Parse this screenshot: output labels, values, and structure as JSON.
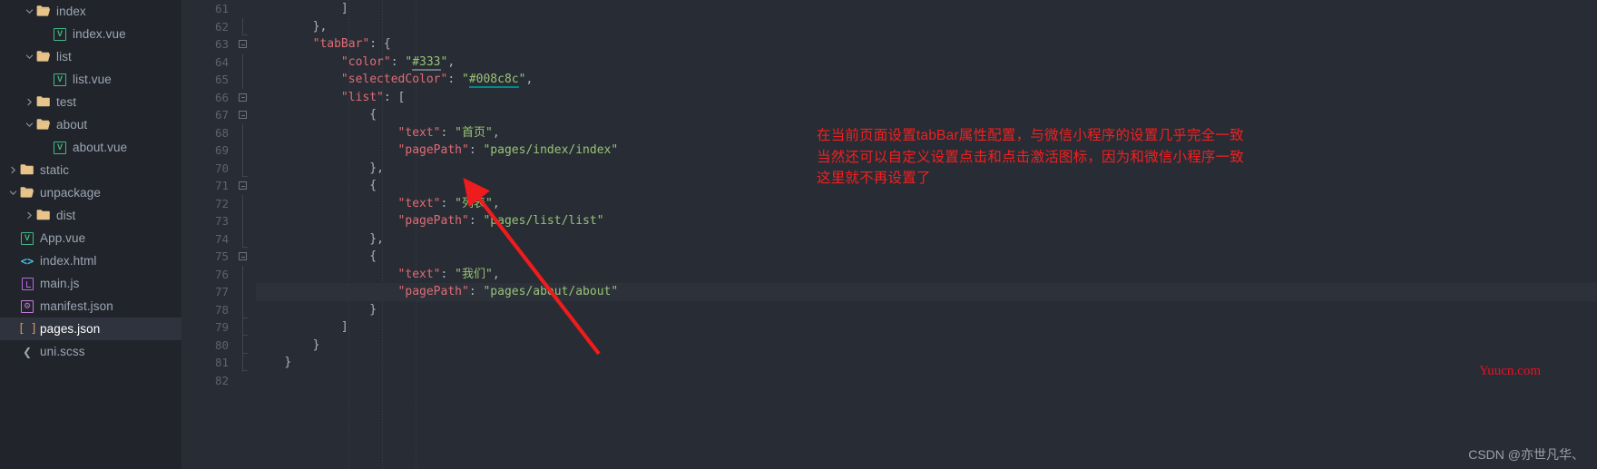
{
  "sidebar": {
    "items": [
      {
        "label": "index",
        "level": 2,
        "chevron": "down",
        "icon": "folder-open-icon",
        "selected": false
      },
      {
        "label": "index.vue",
        "level": 3,
        "chevron": "none",
        "icon": "vue-file-icon",
        "selected": false
      },
      {
        "label": "list",
        "level": 2,
        "chevron": "down",
        "icon": "folder-open-icon",
        "selected": false
      },
      {
        "label": "list.vue",
        "level": 3,
        "chevron": "none",
        "icon": "vue-file-icon",
        "selected": false
      },
      {
        "label": "test",
        "level": 2,
        "chevron": "right",
        "icon": "folder-icon",
        "selected": false
      },
      {
        "label": "about",
        "level": 2,
        "chevron": "down",
        "icon": "folder-open-icon",
        "selected": false
      },
      {
        "label": "about.vue",
        "level": 3,
        "chevron": "none",
        "icon": "vue-file-icon",
        "selected": false
      },
      {
        "label": "static",
        "level": 1,
        "chevron": "right",
        "icon": "folder-icon",
        "selected": false
      },
      {
        "label": "unpackage",
        "level": 1,
        "chevron": "down",
        "icon": "folder-open-icon",
        "selected": false
      },
      {
        "label": "dist",
        "level": 2,
        "chevron": "right",
        "icon": "folder-icon",
        "selected": false
      },
      {
        "label": "App.vue",
        "level": 1,
        "chevron": "none",
        "icon": "vue-file-icon",
        "selected": false
      },
      {
        "label": "index.html",
        "level": 1,
        "chevron": "none",
        "icon": "html-file-icon",
        "selected": false
      },
      {
        "label": "main.js",
        "level": 1,
        "chevron": "none",
        "icon": "js-file-icon",
        "selected": false
      },
      {
        "label": "manifest.json",
        "level": 1,
        "chevron": "none",
        "icon": "manifest-file-icon",
        "selected": false
      },
      {
        "label": "pages.json",
        "level": 1,
        "chevron": "none",
        "icon": "json-file-icon",
        "selected": true
      },
      {
        "label": "uni.scss",
        "level": 1,
        "chevron": "none",
        "icon": "scss-file-icon",
        "selected": false
      }
    ]
  },
  "editor": {
    "first_visible_line": 61,
    "current_line": 77,
    "lines": [
      {
        "num": 61,
        "fold": "none",
        "text": "            ]"
      },
      {
        "num": 62,
        "fold": "bar-end",
        "text": "        },"
      },
      {
        "num": 63,
        "fold": "box",
        "text": "        \"tabBar\": {"
      },
      {
        "num": 64,
        "fold": "bar",
        "text": "            \"color\": \"#333\","
      },
      {
        "num": 65,
        "fold": "bar",
        "text": "            \"selectedColor\": \"#008c8c\","
      },
      {
        "num": 66,
        "fold": "box",
        "text": "            \"list\": ["
      },
      {
        "num": 67,
        "fold": "box",
        "text": "                {"
      },
      {
        "num": 68,
        "fold": "bar",
        "text": "                    \"text\": \"首页\","
      },
      {
        "num": 69,
        "fold": "bar",
        "text": "                    \"pagePath\": \"pages/index/index\""
      },
      {
        "num": 70,
        "fold": "bar-end",
        "text": "                },"
      },
      {
        "num": 71,
        "fold": "box",
        "text": "                {"
      },
      {
        "num": 72,
        "fold": "bar",
        "text": "                    \"text\": \"列表\","
      },
      {
        "num": 73,
        "fold": "bar",
        "text": "                    \"pagePath\": \"pages/list/list\""
      },
      {
        "num": 74,
        "fold": "bar-end",
        "text": "                },"
      },
      {
        "num": 75,
        "fold": "box",
        "text": "                {"
      },
      {
        "num": 76,
        "fold": "bar",
        "text": "                    \"text\": \"我们\","
      },
      {
        "num": 77,
        "fold": "bar",
        "text": "                    \"pagePath\": \"pages/about/about\""
      },
      {
        "num": 78,
        "fold": "bar-end",
        "text": "                }"
      },
      {
        "num": 79,
        "fold": "bar-end",
        "text": "            ]"
      },
      {
        "num": 80,
        "fold": "bar-end",
        "text": "        }"
      },
      {
        "num": 81,
        "fold": "bar-end",
        "text": "    }"
      },
      {
        "num": 82,
        "fold": "none",
        "text": ""
      }
    ],
    "color_swatch_selected": "#008c8c",
    "color_swatch_default": "#333"
  },
  "annotation": {
    "color": "#f22020",
    "lines": [
      "在当前页面设置tabBar属性配置，与微信小程序的设置几乎完全一致",
      "当然还可以自定义设置点击和点击激活图标，因为和微信小程序一致",
      "这里就不再设置了"
    ]
  },
  "watermarks": {
    "site": "Yuucn.com",
    "csdn": "CSDN @亦世凡华、"
  }
}
